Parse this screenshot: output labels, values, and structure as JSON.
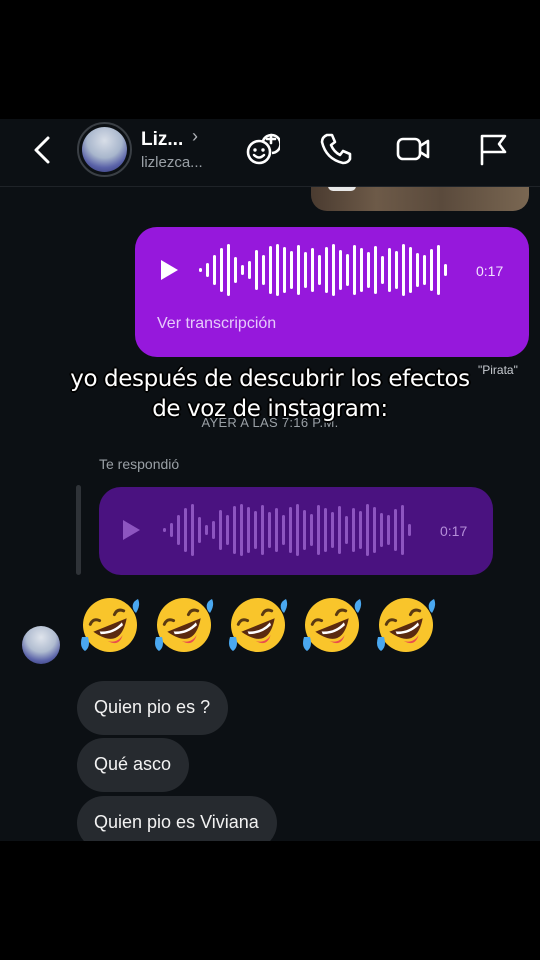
{
  "header": {
    "name": "Liz...",
    "handle": "lizlezca..."
  },
  "messages": {
    "sent_voice": {
      "duration": "0:17",
      "transcript_label": "Ver transcripción"
    },
    "effect_label": "\"Pirata\"",
    "timestamp": "AYER A LAS 7:16 P.M.",
    "replied_label": "Te respondió",
    "reply_voice": {
      "duration": "0:17"
    },
    "emojis": [
      "🤣",
      "🤣",
      "🤣",
      "🤣",
      "🤣"
    ],
    "bubbles": [
      "Quien pio es ?",
      "Qué asco",
      "Quien pio es Viviana"
    ]
  },
  "caption": {
    "line1": "yo después de descubrir los efectos",
    "line2": "de voz de instagram:"
  },
  "colors": {
    "sent_bubble": "#9618dc",
    "reply_bubble": "#4a1280",
    "received_bubble": "#262a2f",
    "background": "#0c1014"
  },
  "icons": [
    "back-arrow-icon",
    "chevron-right-icon",
    "sticker-group-icon",
    "phone-icon",
    "video-camera-icon",
    "flag-icon",
    "play-icon",
    "waveform-icon",
    "rolling-laughing-emoji"
  ]
}
